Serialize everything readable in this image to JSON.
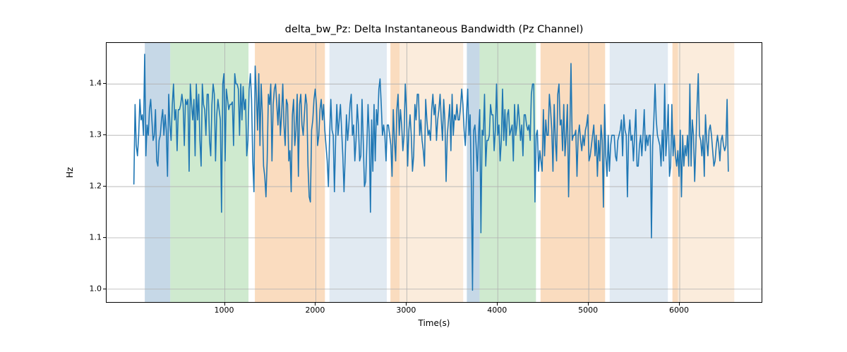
{
  "chart_data": {
    "type": "line",
    "title": "delta_bw_Pz: Delta Instantaneous Bandwidth (Pz Channel)",
    "xlabel": "Time(s)",
    "ylabel": "Hz",
    "xlim": [
      -300,
      6900
    ],
    "ylim": [
      0.975,
      1.48
    ],
    "xticks": [
      1000,
      2000,
      3000,
      4000,
      5000,
      6000
    ],
    "yticks": [
      1.0,
      1.1,
      1.2,
      1.3,
      1.4
    ],
    "bands": [
      {
        "x0": 120,
        "x1": 400,
        "color": "#98b8d3",
        "alpha": 0.55
      },
      {
        "x0": 400,
        "x1": 1260,
        "color": "#a8d8a8",
        "alpha": 0.55
      },
      {
        "x0": 1330,
        "x1": 2100,
        "color": "#f6c08b",
        "alpha": 0.55
      },
      {
        "x0": 2150,
        "x1": 2780,
        "color": "#c9d8e8",
        "alpha": 0.55
      },
      {
        "x0": 2820,
        "x1": 2920,
        "color": "#f6c08b",
        "alpha": 0.55
      },
      {
        "x0": 2920,
        "x1": 3620,
        "color": "#f8ddc0",
        "alpha": 0.55
      },
      {
        "x0": 3660,
        "x1": 3800,
        "color": "#98b8d3",
        "alpha": 0.55
      },
      {
        "x0": 3800,
        "x1": 4420,
        "color": "#a8d8a8",
        "alpha": 0.55
      },
      {
        "x0": 4470,
        "x1": 5180,
        "color": "#f6c08b",
        "alpha": 0.55
      },
      {
        "x0": 5230,
        "x1": 5870,
        "color": "#c9d8e8",
        "alpha": 0.55
      },
      {
        "x0": 5920,
        "x1": 5980,
        "color": "#f6c08b",
        "alpha": 0.55
      },
      {
        "x0": 5980,
        "x1": 6600,
        "color": "#f8ddc0",
        "alpha": 0.55
      }
    ],
    "series": [
      {
        "name": "delta_bw_Pz",
        "x_start": 0,
        "x_step": 13.2,
        "y": [
          1.205,
          1.36,
          1.28,
          1.26,
          1.3,
          1.37,
          1.33,
          1.34,
          1.3,
          1.458,
          1.26,
          1.32,
          1.3,
          1.35,
          1.37,
          1.33,
          1.29,
          1.3,
          1.35,
          1.25,
          1.24,
          1.29,
          1.3,
          1.33,
          1.35,
          1.3,
          1.34,
          1.31,
          1.22,
          1.38,
          1.32,
          1.29,
          1.36,
          1.4,
          1.33,
          1.35,
          1.27,
          1.35,
          1.35,
          1.36,
          1.38,
          1.36,
          1.28,
          1.37,
          1.36,
          1.37,
          1.23,
          1.4,
          1.36,
          1.33,
          1.37,
          1.26,
          1.4,
          1.33,
          1.38,
          1.29,
          1.24,
          1.4,
          1.36,
          1.35,
          1.3,
          1.38,
          1.38,
          1.29,
          1.26,
          1.36,
          1.4,
          1.38,
          1.25,
          1.34,
          1.37,
          1.35,
          1.33,
          1.15,
          1.4,
          1.42,
          1.25,
          1.39,
          1.37,
          1.35,
          1.36,
          1.36,
          1.365,
          1.28,
          1.42,
          1.4,
          1.4,
          1.39,
          1.3,
          1.4,
          1.33,
          1.395,
          1.35,
          1.37,
          1.26,
          1.29,
          1.39,
          1.42,
          1.37,
          1.25,
          1.19,
          1.435,
          1.38,
          1.31,
          1.42,
          1.28,
          1.4,
          1.34,
          1.24,
          1.22,
          1.18,
          1.25,
          1.38,
          1.36,
          1.4,
          1.25,
          1.36,
          1.39,
          1.4,
          1.36,
          1.32,
          1.38,
          1.3,
          1.34,
          1.4,
          1.32,
          1.28,
          1.37,
          1.36,
          1.25,
          1.27,
          1.19,
          1.34,
          1.37,
          1.28,
          1.31,
          1.38,
          1.22,
          1.36,
          1.38,
          1.32,
          1.3,
          1.34,
          1.38,
          1.36,
          1.24,
          1.18,
          1.17,
          1.31,
          1.33,
          1.37,
          1.39,
          1.36,
          1.28,
          1.3,
          1.35,
          1.37,
          1.33,
          1.36,
          1.31,
          1.28,
          1.25,
          1.2,
          1.3,
          1.37,
          1.31,
          1.3,
          1.19,
          1.29,
          1.36,
          1.3,
          1.33,
          1.36,
          1.31,
          1.26,
          1.19,
          1.26,
          1.34,
          1.29,
          1.32,
          1.36,
          1.38,
          1.3,
          1.32,
          1.25,
          1.29,
          1.36,
          1.32,
          1.25,
          1.26,
          1.37,
          1.29,
          1.2,
          1.21,
          1.28,
          1.36,
          1.3,
          1.15,
          1.33,
          1.23,
          1.36,
          1.25,
          1.35,
          1.32,
          1.39,
          1.41,
          1.36,
          1.3,
          1.32,
          1.3,
          1.25,
          1.32,
          1.32,
          1.3,
          1.28,
          1.22,
          1.35,
          1.29,
          1.25,
          1.35,
          1.38,
          1.3,
          1.35,
          1.32,
          1.27,
          1.3,
          1.4,
          1.35,
          1.24,
          1.31,
          1.34,
          1.3,
          1.23,
          1.26,
          1.36,
          1.33,
          1.38,
          1.38,
          1.3,
          1.33,
          1.29,
          1.27,
          1.24,
          1.37,
          1.33,
          1.3,
          1.31,
          1.29,
          1.35,
          1.38,
          1.34,
          1.36,
          1.29,
          1.33,
          1.35,
          1.38,
          1.33,
          1.29,
          1.37,
          1.33,
          1.21,
          1.3,
          1.33,
          1.36,
          1.27,
          1.38,
          1.3,
          1.34,
          1.33,
          1.36,
          1.33,
          1.33,
          1.355,
          1.39,
          1.36,
          1.31,
          1.28,
          1.34,
          1.39,
          1.3,
          1.34,
          1.21,
          0.998,
          1.31,
          1.32,
          1.28,
          1.23,
          1.3,
          1.35,
          1.11,
          1.31,
          1.3,
          1.38,
          1.24,
          1.29,
          1.29,
          1.3,
          1.36,
          1.34,
          1.34,
          1.27,
          1.31,
          1.4,
          1.3,
          1.32,
          1.25,
          1.29,
          1.39,
          1.29,
          1.35,
          1.28,
          1.34,
          1.35,
          1.3,
          1.31,
          1.32,
          1.25,
          1.36,
          1.3,
          1.32,
          1.36,
          1.33,
          1.29,
          1.32,
          1.26,
          1.34,
          1.34,
          1.32,
          1.31,
          1.32,
          1.29,
          1.38,
          1.4,
          1.4,
          1.17,
          1.3,
          1.31,
          1.23,
          1.27,
          1.25,
          1.23,
          1.35,
          1.26,
          1.33,
          1.3,
          1.3,
          1.38,
          1.35,
          1.31,
          1.23,
          1.36,
          1.29,
          1.25,
          1.38,
          1.4,
          1.32,
          1.33,
          1.27,
          1.36,
          1.26,
          1.3,
          1.36,
          1.18,
          1.3,
          1.44,
          1.29,
          1.3,
          1.3,
          1.31,
          1.22,
          1.3,
          1.32,
          1.29,
          1.27,
          1.3,
          1.28,
          1.31,
          1.32,
          1.34,
          1.25,
          1.26,
          1.28,
          1.3,
          1.32,
          1.26,
          1.3,
          1.22,
          1.29,
          1.25,
          1.32,
          1.29,
          1.16,
          1.36,
          1.26,
          1.22,
          1.3,
          1.23,
          1.28,
          1.3,
          1.3,
          1.3,
          1.26,
          1.25,
          1.29,
          1.3,
          1.31,
          1.33,
          1.26,
          1.34,
          1.31,
          1.3,
          1.18,
          1.3,
          1.33,
          1.29,
          1.3,
          1.25,
          1.3,
          1.35,
          1.24,
          1.24,
          1.28,
          1.3,
          1.26,
          1.3,
          1.35,
          1.27,
          1.3,
          1.28,
          1.3,
          1.3,
          1.1,
          1.28,
          1.33,
          1.4,
          1.33,
          1.3,
          1.29,
          1.28,
          1.24,
          1.31,
          1.25,
          1.4,
          1.26,
          1.3,
          1.36,
          1.22,
          1.24,
          1.36,
          1.26,
          1.3,
          1.26,
          1.24,
          1.27,
          1.22,
          1.31,
          1.18,
          1.3,
          1.24,
          1.28,
          1.26,
          1.3,
          1.24,
          1.4,
          1.24,
          1.33,
          1.3,
          1.21,
          1.28,
          1.36,
          1.42,
          1.3,
          1.29,
          1.26,
          1.3,
          1.22,
          1.34,
          1.29,
          1.26,
          1.31,
          1.32,
          1.3,
          1.27,
          1.24,
          1.25,
          1.28,
          1.3,
          1.28,
          1.25,
          1.29,
          1.3,
          1.28,
          1.27,
          1.28,
          1.37,
          1.23
        ]
      }
    ]
  }
}
